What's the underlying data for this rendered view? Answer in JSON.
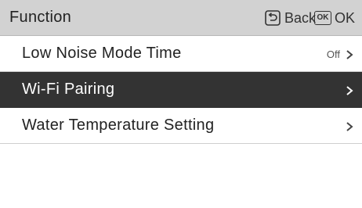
{
  "header": {
    "title": "Function",
    "back_label": "Back",
    "ok_badge": "OK",
    "ok_label": "OK",
    "back_icon": "back-return-icon",
    "ok_icon": "ok-key-icon"
  },
  "menu": {
    "items": [
      {
        "label": "Low Noise Mode Time",
        "value": "Off",
        "selected": false
      },
      {
        "label": "Wi-Fi Pairing",
        "value": "",
        "selected": true
      },
      {
        "label": "Water Temperature Setting",
        "value": "",
        "selected": false
      }
    ]
  },
  "colors": {
    "header_bg": "#d2d2d2",
    "selected_bg": "#333333",
    "selected_text": "#ffffff",
    "text": "#222222"
  }
}
